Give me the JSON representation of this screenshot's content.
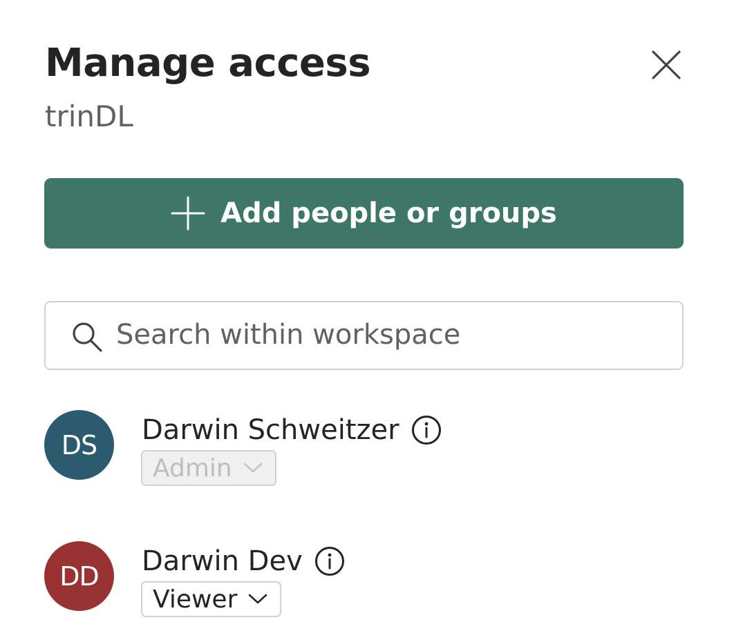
{
  "header": {
    "title": "Manage access",
    "subtitle": "trinDL",
    "close_icon": "close-icon"
  },
  "add_button": {
    "label": "Add people or groups",
    "icon": "plus-icon",
    "color": "#3e7767"
  },
  "search": {
    "placeholder": "Search within workspace",
    "value": "",
    "icon": "search-icon"
  },
  "members": [
    {
      "initials": "DS",
      "name": "Darwin Schweitzer",
      "role": "Admin",
      "role_disabled": true,
      "avatar_color": "#2c5b70"
    },
    {
      "initials": "DD",
      "name": "Darwin Dev",
      "role": "Viewer",
      "role_disabled": false,
      "avatar_color": "#993232"
    }
  ]
}
